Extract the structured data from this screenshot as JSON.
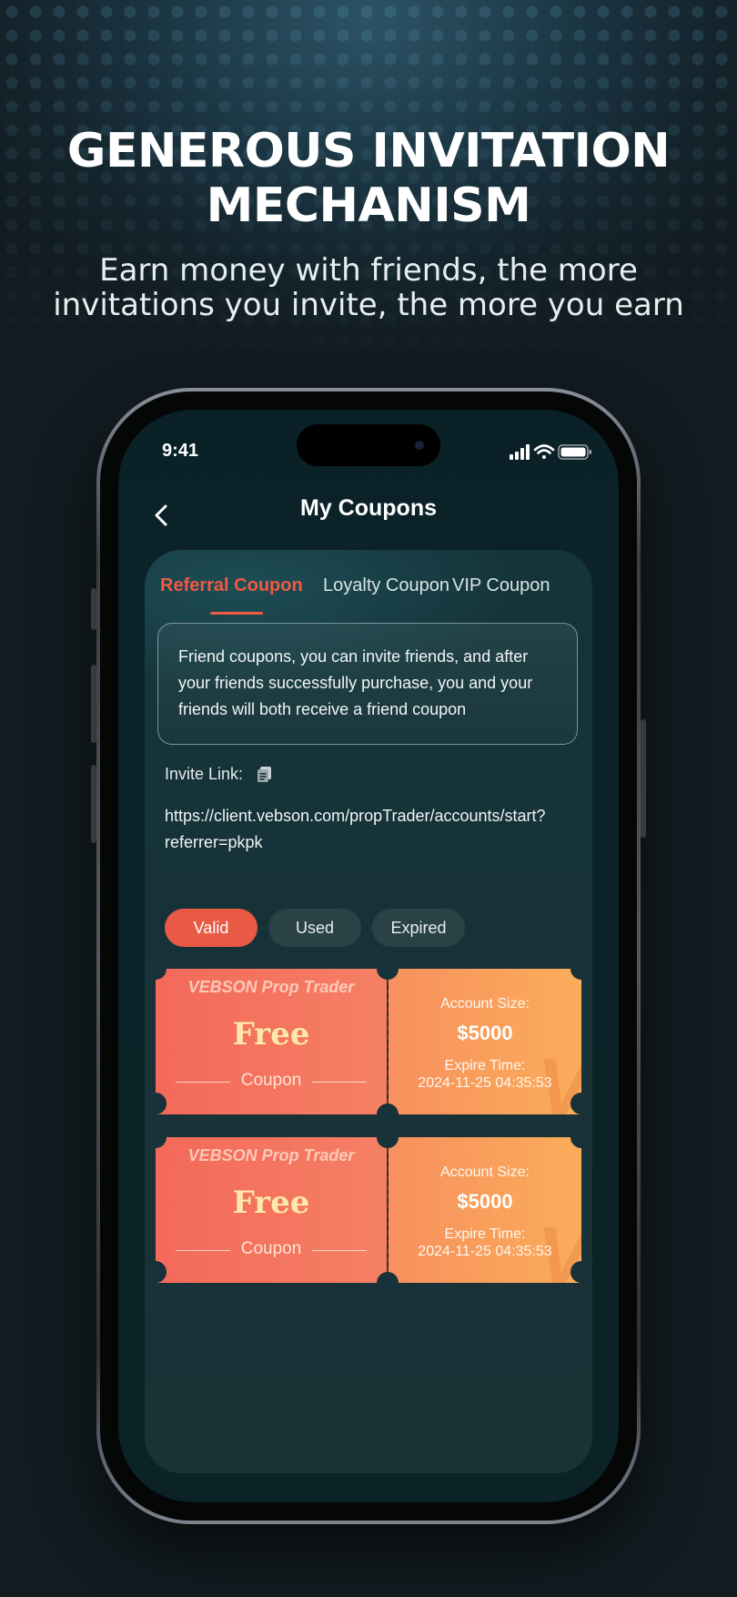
{
  "headline": {
    "line1": "GENEROUS INVITATION",
    "line2": "MECHANISM",
    "sub_line1": "Earn money with friends, the more",
    "sub_line2": "invitations you invite, the more you earn"
  },
  "status_bar": {
    "time": "9:41"
  },
  "nav": {
    "title": "My Coupons"
  },
  "tabs": [
    {
      "label": "Referral Coupon",
      "active": true
    },
    {
      "label": "Loyalty  Coupon",
      "active": false
    },
    {
      "label": "VIP Coupon",
      "active": false
    }
  ],
  "info": {
    "line1": "Friend coupons, you can invite friends, and after",
    "line2": "your friends successfully purchase, you and your",
    "line3": "friends will both receive a friend coupon"
  },
  "invite": {
    "label": "Invite Link:",
    "link_line1": "https://client.vebson.com/propTrader/accounts/start?",
    "link_line2": "referrer=pkpk"
  },
  "filters": [
    {
      "label": "Valid",
      "active": true
    },
    {
      "label": "Used",
      "active": false
    },
    {
      "label": "Expired",
      "active": false
    }
  ],
  "coupons": [
    {
      "brand": "VEBSON Prop Trader",
      "title": "Free",
      "subtitle": "Coupon",
      "size_label": "Account Size:",
      "size_value": "$5000",
      "expire_label": "Expire Time:",
      "expire_value": "2024-11-25 04:35:53"
    },
    {
      "brand": "VEBSON Prop Trader",
      "title": "Free",
      "subtitle": "Coupon",
      "size_label": "Account Size:",
      "size_value": "$5000",
      "expire_label": "Expire Time:",
      "expire_value": "2024-11-25 04:35:53"
    }
  ],
  "colors": {
    "accent": "#f05a44",
    "coupon_left": "#f4695a",
    "coupon_right": "#fbad5a",
    "card_bg": "#173238"
  }
}
